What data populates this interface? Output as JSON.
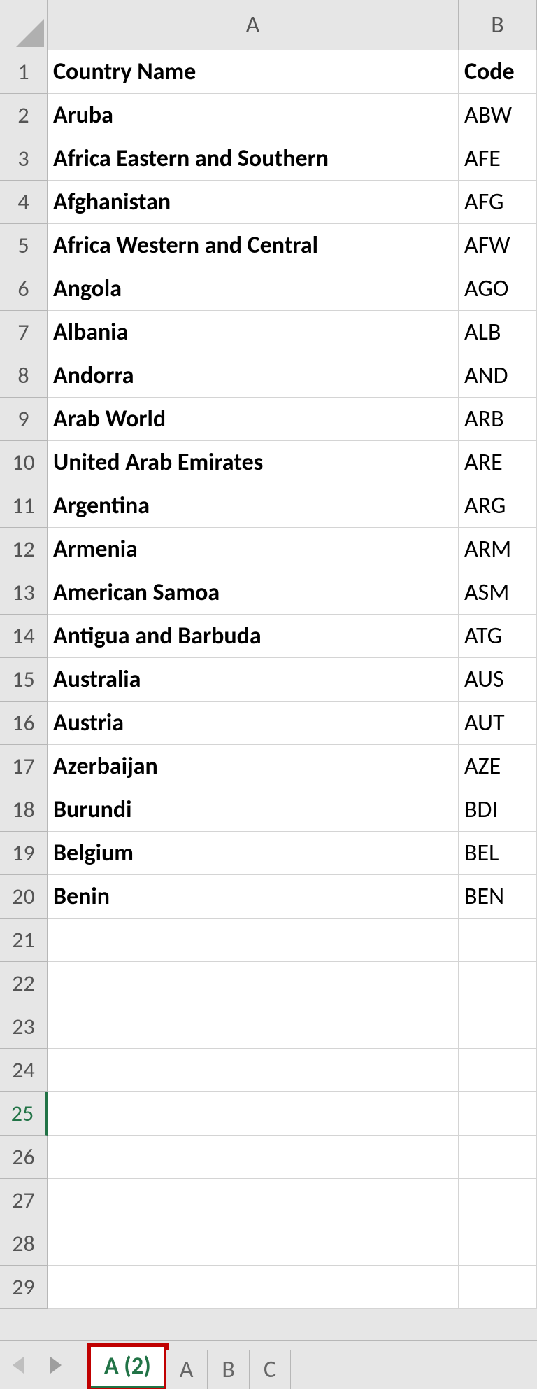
{
  "columns": {
    "A": "A",
    "B": "B"
  },
  "rowNumbers": [
    "1",
    "2",
    "3",
    "4",
    "5",
    "6",
    "7",
    "8",
    "9",
    "10",
    "11",
    "12",
    "13",
    "14",
    "15",
    "16",
    "17",
    "18",
    "19",
    "20",
    "21",
    "22",
    "23",
    "24",
    "25",
    "26",
    "27",
    "28",
    "29"
  ],
  "activeRow": 25,
  "rows": [
    {
      "a": "Country Name",
      "b": "Code",
      "boldA": true,
      "boldB": true
    },
    {
      "a": "Aruba",
      "b": "ABW",
      "boldA": true,
      "boldB": false
    },
    {
      "a": "Africa Eastern and Southern",
      "b": "AFE",
      "boldA": true,
      "boldB": false
    },
    {
      "a": "Afghanistan",
      "b": "AFG",
      "boldA": true,
      "boldB": false
    },
    {
      "a": "Africa Western and Central",
      "b": "AFW",
      "boldA": true,
      "boldB": false
    },
    {
      "a": "Angola",
      "b": "AGO",
      "boldA": true,
      "boldB": false
    },
    {
      "a": "Albania",
      "b": "ALB",
      "boldA": true,
      "boldB": false
    },
    {
      "a": "Andorra",
      "b": "AND",
      "boldA": true,
      "boldB": false
    },
    {
      "a": "Arab World",
      "b": "ARB",
      "boldA": true,
      "boldB": false
    },
    {
      "a": "United Arab Emirates",
      "b": "ARE",
      "boldA": true,
      "boldB": false
    },
    {
      "a": "Argentina",
      "b": "ARG",
      "boldA": true,
      "boldB": false
    },
    {
      "a": "Armenia",
      "b": "ARM",
      "boldA": true,
      "boldB": false
    },
    {
      "a": "American Samoa",
      "b": "ASM",
      "boldA": true,
      "boldB": false
    },
    {
      "a": "Antigua and Barbuda",
      "b": "ATG",
      "boldA": true,
      "boldB": false
    },
    {
      "a": "Australia",
      "b": "AUS",
      "boldA": true,
      "boldB": false
    },
    {
      "a": "Austria",
      "b": "AUT",
      "boldA": true,
      "boldB": false
    },
    {
      "a": "Azerbaijan",
      "b": "AZE",
      "boldA": true,
      "boldB": false
    },
    {
      "a": "Burundi",
      "b": "BDI",
      "boldA": true,
      "boldB": false
    },
    {
      "a": "Belgium",
      "b": "BEL",
      "boldA": true,
      "boldB": false
    },
    {
      "a": "Benin",
      "b": "BEN",
      "boldA": true,
      "boldB": false
    },
    {
      "a": "",
      "b": "",
      "boldA": false,
      "boldB": false
    },
    {
      "a": "",
      "b": "",
      "boldA": false,
      "boldB": false
    },
    {
      "a": "",
      "b": "",
      "boldA": false,
      "boldB": false
    },
    {
      "a": "",
      "b": "",
      "boldA": false,
      "boldB": false
    },
    {
      "a": "",
      "b": "",
      "boldA": false,
      "boldB": false
    },
    {
      "a": "",
      "b": "",
      "boldA": false,
      "boldB": false
    },
    {
      "a": "",
      "b": "",
      "boldA": false,
      "boldB": false
    },
    {
      "a": "",
      "b": "",
      "boldA": false,
      "boldB": false
    },
    {
      "a": "",
      "b": "",
      "boldA": false,
      "boldB": false
    }
  ],
  "tabs": {
    "active": "A (2)",
    "others": [
      "A",
      "B",
      "C"
    ]
  }
}
